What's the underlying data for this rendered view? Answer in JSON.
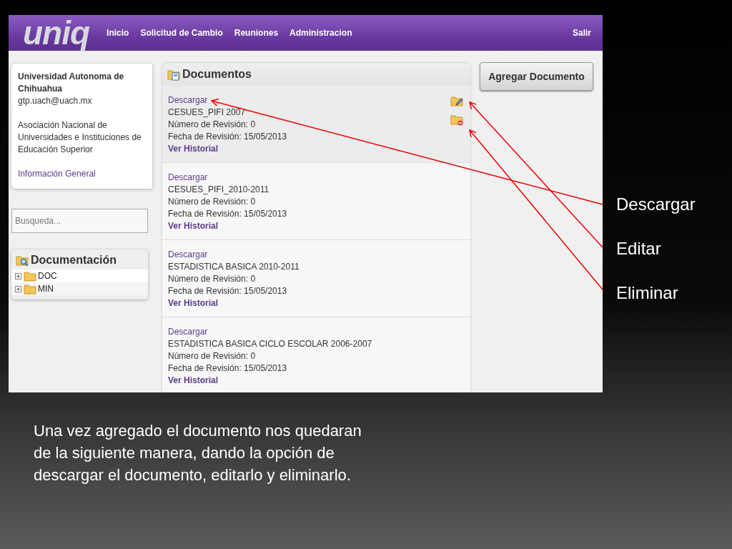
{
  "header": {
    "logo": "uniq",
    "nav": [
      {
        "label": "Inicio"
      },
      {
        "label": "Solicitud de Cambio"
      },
      {
        "label": "Reuniones"
      },
      {
        "label": "Administracion"
      }
    ],
    "logout": "Salir"
  },
  "institution_card": {
    "name": "Universidad Autonoma de Chihuahua",
    "email": "gtp.uach@uach.mx",
    "organization": "Asociación Nacional de Universidades e Instituciones de Educación Superior",
    "link": "Información General"
  },
  "search": {
    "placeholder": "Busqueda..."
  },
  "documentation": {
    "title": "Documentación",
    "tree": [
      {
        "label": "DOC",
        "expanded": false
      },
      {
        "label": "MIN",
        "expanded": false
      }
    ]
  },
  "documents": {
    "title": "Documentos",
    "items": [
      {
        "download": "Descargar",
        "name": "CESUES_PIFI 2007",
        "revision": "Número de Revisión: 0",
        "date": "Fecha de Revisión: 15/05/2013",
        "history": "Ver Historial",
        "selected": true
      },
      {
        "download": "Descargar",
        "name": "CESUES_PIFI_2010-2011",
        "revision": "Número de Revisión: 0",
        "date": "Fecha de Revisión: 15/05/2013",
        "history": "Ver Historial",
        "selected": false
      },
      {
        "download": "Descargar",
        "name": "ESTADISTICA BASICA 2010-2011",
        "revision": "Número de Revisión: 0",
        "date": "Fecha de Revisión: 15/05/2013",
        "history": "Ver Historial",
        "selected": false
      },
      {
        "download": "Descargar",
        "name": "ESTADISTICA BASICA CICLO ESCOLAR 2006-2007",
        "revision": "Número de Revisión: 0",
        "date": "Fecha de Revisión: 15/05/2013",
        "history": "Ver Historial",
        "selected": false
      }
    ]
  },
  "add_button": "Agregar Documento",
  "callouts": [
    {
      "label": "Descargar"
    },
    {
      "label": "Editar"
    },
    {
      "label": "Eliminar"
    }
  ],
  "caption": "Una vez agregado el documento nos quedaran de la siguiente manera, dando la opción de descargar el documento, editarlo y eliminarlo."
}
